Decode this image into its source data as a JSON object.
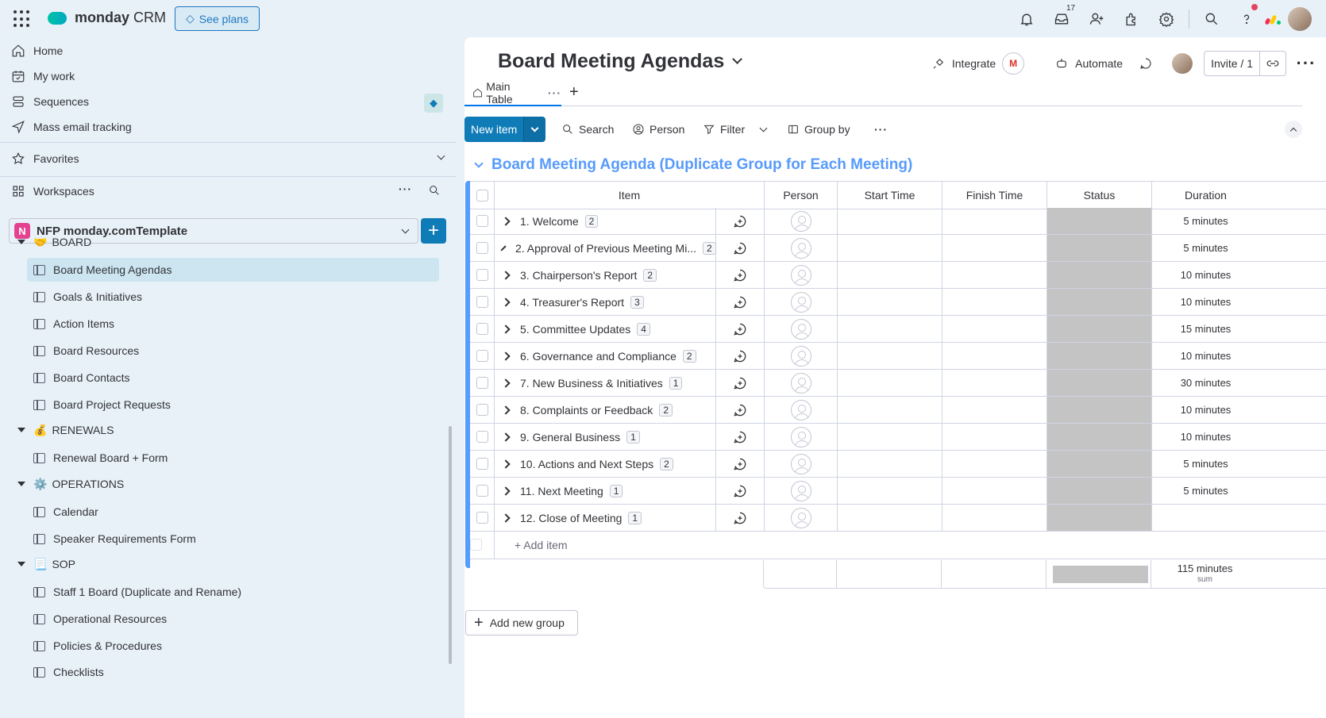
{
  "app": {
    "logo_brand": "monday",
    "logo_product": "CRM",
    "see_plans": "See plans",
    "inbox_badge": "17"
  },
  "sidebar": {
    "nav": [
      {
        "label": "Home",
        "icon": "home-icon"
      },
      {
        "label": "My work",
        "icon": "calendar-check-icon"
      },
      {
        "label": "Sequences",
        "icon": "sequences-icon"
      },
      {
        "label": "Mass email tracking",
        "icon": "send-icon"
      }
    ],
    "favorites": "Favorites",
    "workspaces": "Workspaces",
    "workspace_badge": "N",
    "workspace_name": "NFP monday.comTemplate",
    "folders": [
      {
        "emoji": "🤝",
        "label": "BOARD"
      },
      {
        "emoji": "💰",
        "label": "RENEWALS"
      },
      {
        "emoji": "⚙️",
        "label": "OPERATIONS"
      },
      {
        "emoji": "📃",
        "label": "SOP"
      }
    ],
    "boards": [
      "Board Meeting Agendas",
      "Goals & Initiatives",
      "Action Items",
      "Board Resources",
      "Board Contacts",
      "Board Project Requests",
      "Renewal Board + Form",
      "Calendar",
      "Speaker Requirements Form",
      "Staff 1 Board (Duplicate and Rename)",
      "Operational Resources",
      "Policies & Procedures",
      "Checklists"
    ]
  },
  "header": {
    "board_title": "Board Meeting Agendas",
    "integrate": "Integrate",
    "gmail_letter": "M",
    "automate": "Automate",
    "invite": "Invite / 1"
  },
  "tabs": {
    "main_table": "Main Table"
  },
  "toolbar": {
    "new_item": "New item",
    "search": "Search",
    "person": "Person",
    "filter": "Filter",
    "group_by": "Group by"
  },
  "group": {
    "title": "Board Meeting Agenda (Duplicate Group for Each Meeting)",
    "color": "#579bfc",
    "columns": {
      "item": "Item",
      "person": "Person",
      "start_time": "Start Time",
      "finish_time": "Finish Time",
      "status": "Status",
      "duration": "Duration"
    },
    "rows": [
      {
        "name": "1. Welcome",
        "subitems": "2",
        "duration": "5 minutes"
      },
      {
        "name": "2. Approval of Previous Meeting Mi...",
        "subitems": "2",
        "duration": "5 minutes"
      },
      {
        "name": "3. Chairperson's Report",
        "subitems": "2",
        "duration": "10 minutes"
      },
      {
        "name": "4. Treasurer's Report",
        "subitems": "3",
        "duration": "10 minutes"
      },
      {
        "name": "5. Committee Updates",
        "subitems": "4",
        "duration": "15 minutes"
      },
      {
        "name": "6. Governance and Compliance",
        "subitems": "2",
        "duration": "10 minutes"
      },
      {
        "name": "7. New Business & Initiatives",
        "subitems": "1",
        "duration": "30 minutes"
      },
      {
        "name": "8. Complaints or Feedback",
        "subitems": "2",
        "duration": "10 minutes"
      },
      {
        "name": "9. General Business",
        "subitems": "1",
        "duration": "10 minutes"
      },
      {
        "name": "10. Actions and Next Steps",
        "subitems": "2",
        "duration": "5 minutes"
      },
      {
        "name": "11. Next Meeting",
        "subitems": "1",
        "duration": "5 minutes"
      },
      {
        "name": "12. Close of Meeting",
        "subitems": "1",
        "duration": ""
      }
    ],
    "add_item": "+ Add item",
    "sum_value": "115 minutes",
    "sum_label": "sum"
  },
  "add_new_group": "Add new group"
}
